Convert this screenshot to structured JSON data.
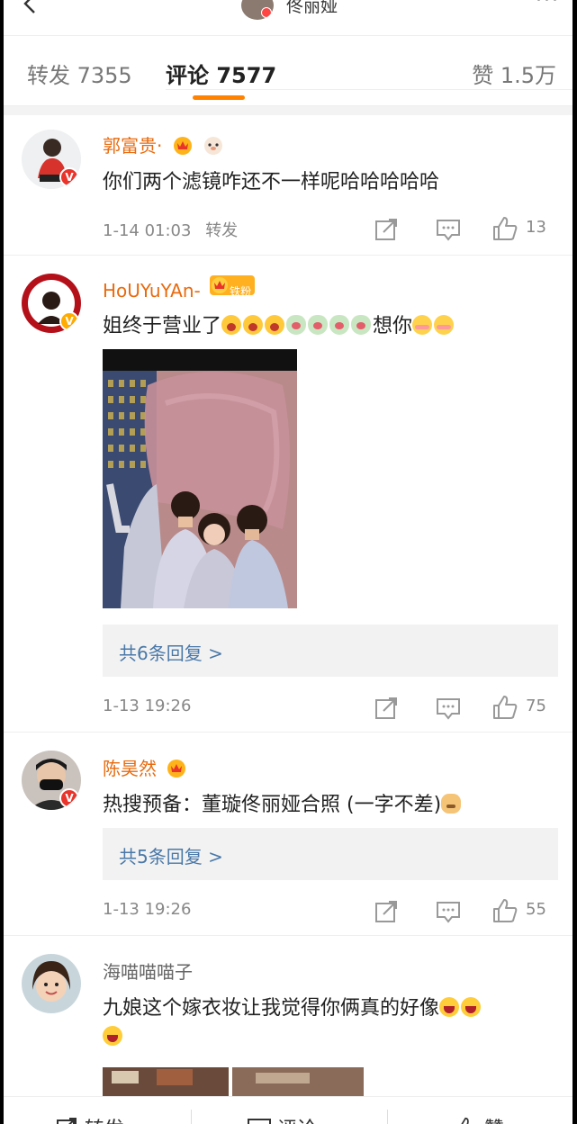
{
  "header": {
    "title": "佟丽娅"
  },
  "tabs": {
    "repost": "转发 7355",
    "comments": "评论 7577",
    "likes": "赞 1.5万"
  },
  "comments": [
    {
      "user": "郭富贵·",
      "text": "你们两个滤镜咋还不一样呢哈哈哈哈哈",
      "time": "1-14 01:03",
      "repost_label": "转发",
      "likes": "13"
    },
    {
      "user": "HoUYuYAn-",
      "fan_badge": "铁粉",
      "text_start": "姐终于营业了",
      "text_mid": "想你",
      "reply_label": "共6条回复 >",
      "time": "1-13 19:26",
      "likes": "75"
    },
    {
      "user": "陈昊然",
      "text": "热搜预备：董璇佟丽娅合照 (一字不差)",
      "reply_label": "共5条回复 >",
      "time": "1-13 19:26",
      "likes": "55"
    },
    {
      "user": "海喵喵喵子",
      "text": "九娘这个嫁衣妆让我觉得你俩真的好像"
    }
  ],
  "bottom_bar": {
    "repost": "转发",
    "comment": "评论",
    "like": "赞"
  },
  "colors": {
    "accent": "#ff8200",
    "username": "#e86b0f",
    "link": "#4a78a8"
  }
}
